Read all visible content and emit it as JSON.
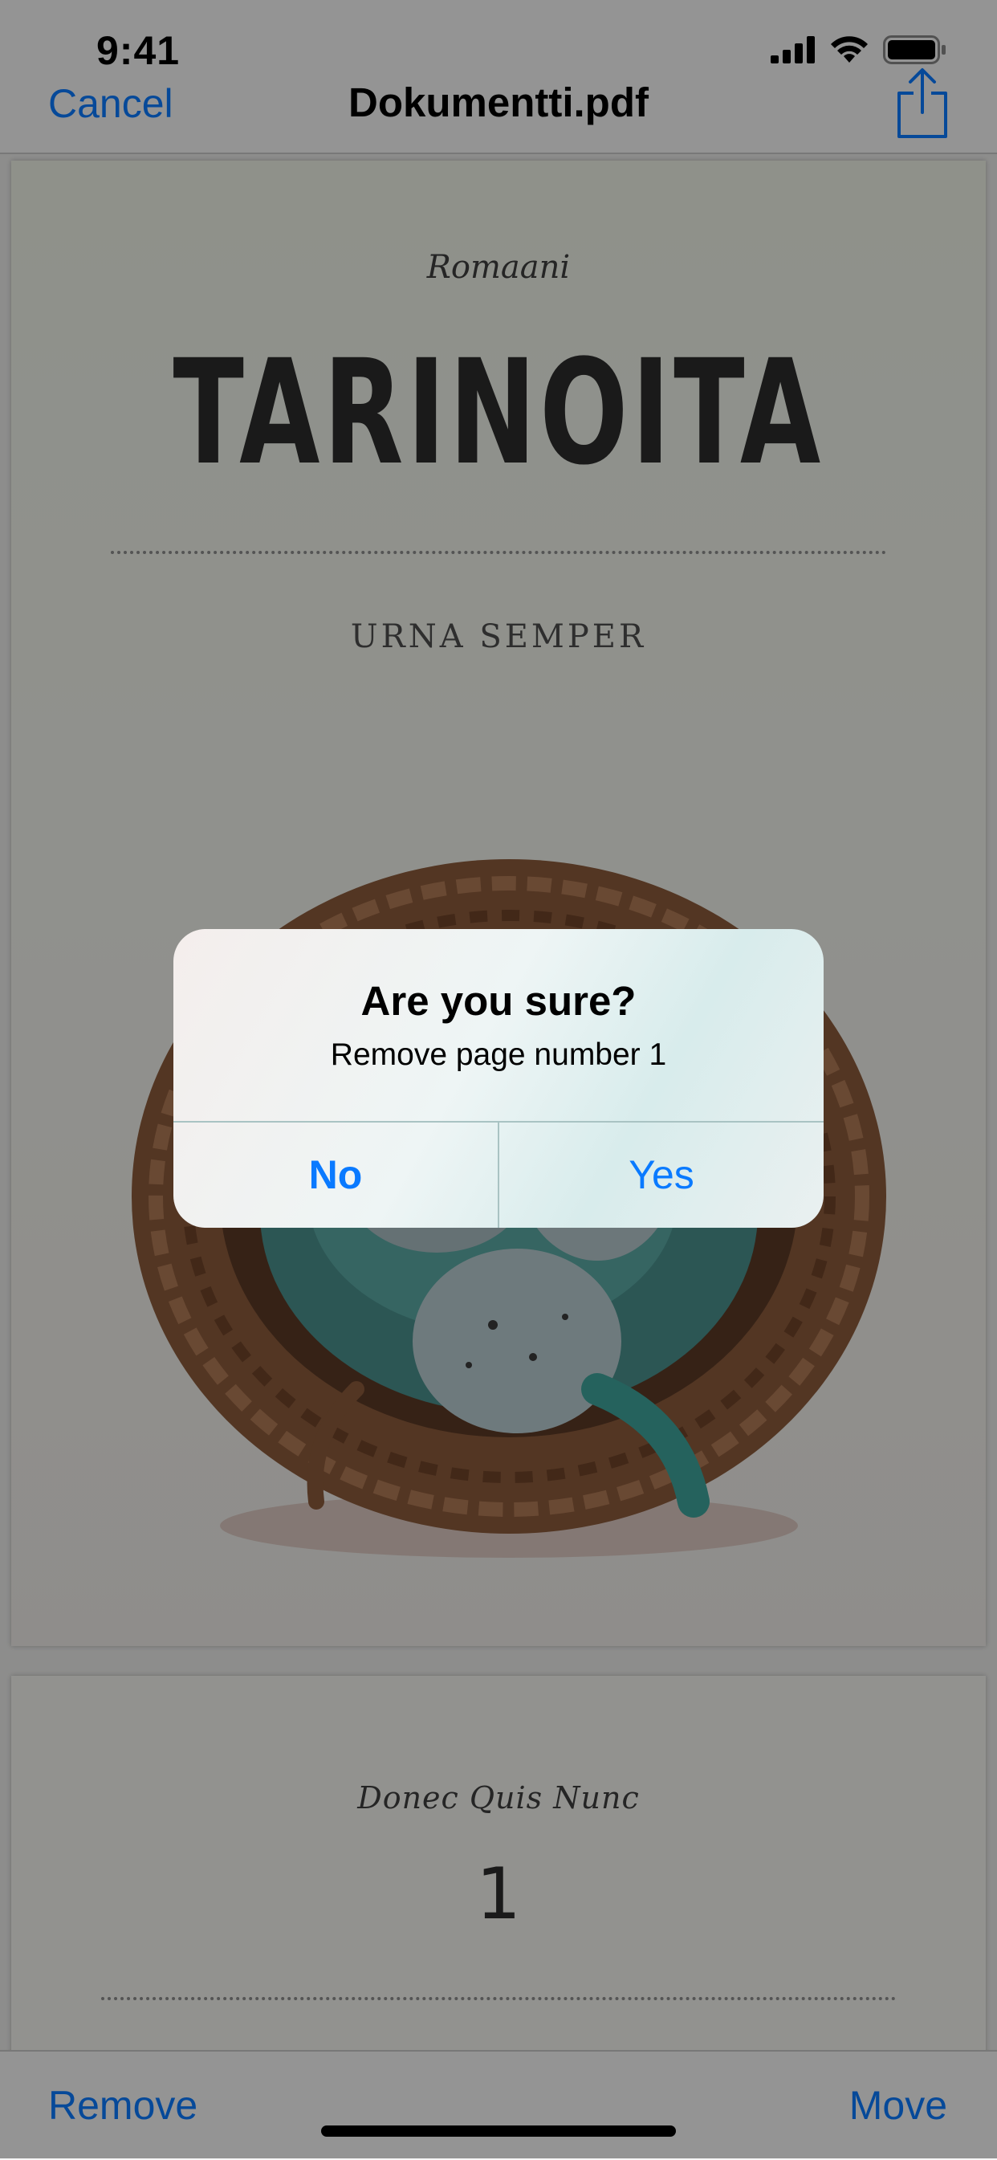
{
  "status_bar": {
    "time": "9:41",
    "icons": [
      "cellular-signal-icon",
      "wifi-icon",
      "battery-icon"
    ]
  },
  "nav": {
    "cancel_label": "Cancel",
    "title": "Dokumentti.pdf",
    "share_icon": "share-icon"
  },
  "document": {
    "page1": {
      "genre": "Romaani",
      "title": "TARINOITA",
      "author": "URNA SEMPER",
      "image": "bird-nest-with-eggs"
    },
    "page2": {
      "subtitle": "Donec Quis Nunc",
      "number": "1"
    }
  },
  "toolbar": {
    "remove_label": "Remove",
    "move_label": "Move"
  },
  "alert": {
    "title": "Are you sure?",
    "message": "Remove page number 1",
    "no_label": "No",
    "yes_label": "Yes"
  },
  "colors": {
    "accent": "#0a7aff",
    "bar_background": "#f7f7f7"
  }
}
